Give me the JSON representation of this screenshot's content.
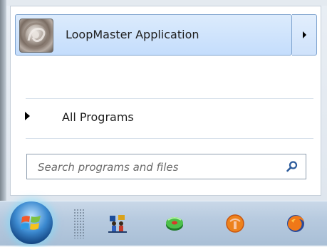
{
  "start_menu": {
    "pinned_program": {
      "label": "LoopMaster Application",
      "icon": "loopmaster-app-icon",
      "submenu_icon": "chevron-right-icon"
    },
    "all_programs": {
      "label": "All Programs",
      "icon": "triangle-right-icon"
    },
    "search": {
      "placeholder": "Search programs and files",
      "icon": "magnifier-icon"
    }
  },
  "taskbar": {
    "start_button": "windows-start-orb",
    "icons": [
      "quick-launch-gripper",
      "network-people-icon",
      "green-disc-icon",
      "orange-app-icon",
      "firefox-icon"
    ]
  },
  "colors": {
    "highlight": "#c4ddfc",
    "highlight_border": "#7da2ce",
    "taskbar": "#b7cadf",
    "orb_glow": "#78dcff"
  }
}
